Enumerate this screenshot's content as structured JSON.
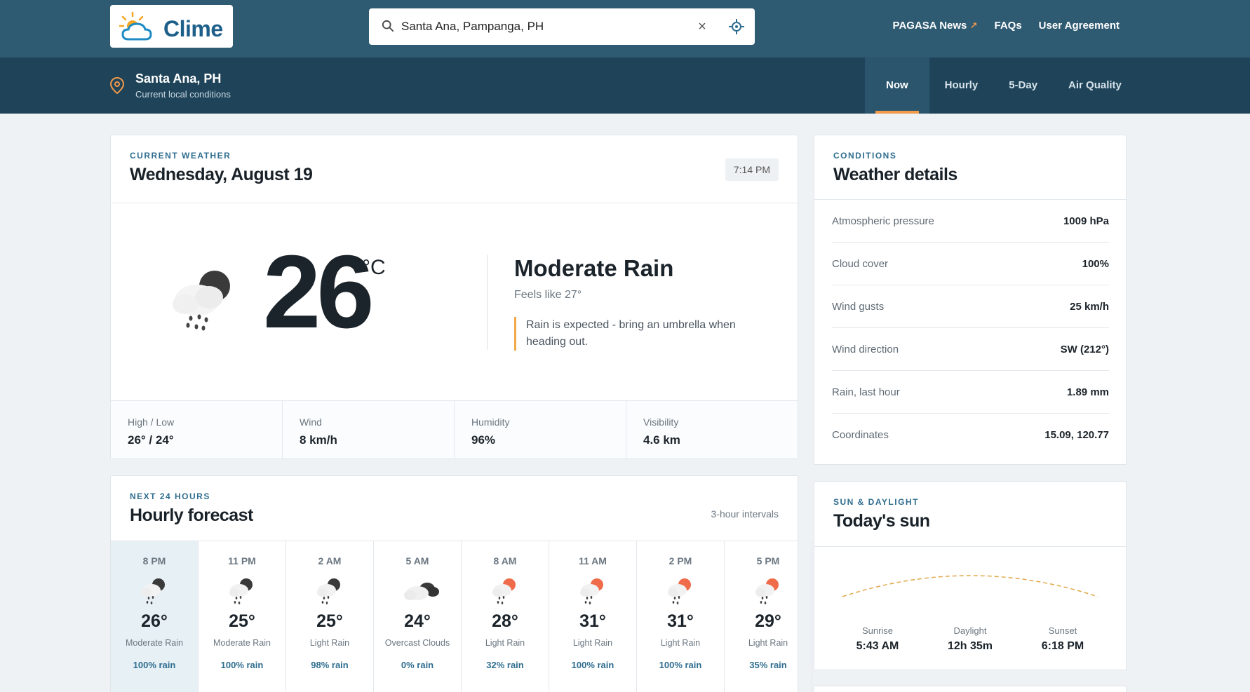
{
  "brand": {
    "name": "Clime"
  },
  "search": {
    "value": "Santa Ana, Pampanga, PH",
    "placeholder": ""
  },
  "topnav": {
    "news": "PAGASA News",
    "faqs": "FAQs",
    "agreement": "User Agreement"
  },
  "location": {
    "name": "Santa Ana, PH",
    "subtitle": "Current local conditions"
  },
  "tabs": [
    {
      "label": "Now"
    },
    {
      "label": "Hourly"
    },
    {
      "label": "5-Day"
    },
    {
      "label": "Air Quality"
    }
  ],
  "current": {
    "eyebrow": "Current weather",
    "date": "Wednesday, August 19",
    "time": "7:14 PM",
    "temp": "26",
    "unit": "°C",
    "condition": "Moderate Rain",
    "feels_like": "Feels like 27°",
    "advice": "Rain is expected - bring an umbrella when heading out.",
    "icon": "rain-night-icon",
    "stats": [
      {
        "label": "High / Low",
        "value": "26° / 24°"
      },
      {
        "label": "Wind",
        "value": "8 km/h"
      },
      {
        "label": "Humidity",
        "value": "96%"
      },
      {
        "label": "Visibility",
        "value": "4.6 km"
      }
    ]
  },
  "hourly": {
    "eyebrow": "Next 24 hours",
    "title": "Hourly forecast",
    "interval": "3-hour intervals",
    "items": [
      {
        "time": "8 PM",
        "temp": "26°",
        "cond": "Moderate Rain",
        "rain": "100% rain",
        "icon": "rain-night-icon"
      },
      {
        "time": "11 PM",
        "temp": "25°",
        "cond": "Moderate Rain",
        "rain": "100% rain",
        "icon": "rain-night-icon"
      },
      {
        "time": "2 AM",
        "temp": "25°",
        "cond": "Light Rain",
        "rain": "98% rain",
        "icon": "rain-night-icon"
      },
      {
        "time": "5 AM",
        "temp": "24°",
        "cond": "Overcast Clouds",
        "rain": "0% rain",
        "icon": "overcast-clouds-icon"
      },
      {
        "time": "8 AM",
        "temp": "28°",
        "cond": "Light Rain",
        "rain": "32% rain",
        "icon": "rain-day-icon"
      },
      {
        "time": "11 AM",
        "temp": "31°",
        "cond": "Light Rain",
        "rain": "100% rain",
        "icon": "rain-day-icon"
      },
      {
        "time": "2 PM",
        "temp": "31°",
        "cond": "Light Rain",
        "rain": "100% rain",
        "icon": "rain-day-icon"
      },
      {
        "time": "5 PM",
        "temp": "29°",
        "cond": "Light Rain",
        "rain": "35% rain",
        "icon": "rain-day-icon"
      }
    ]
  },
  "details": {
    "eyebrow": "Conditions",
    "title": "Weather details",
    "rows": [
      {
        "label": "Atmospheric pressure",
        "value": "1009 hPa"
      },
      {
        "label": "Cloud cover",
        "value": "100%"
      },
      {
        "label": "Wind gusts",
        "value": "25 km/h"
      },
      {
        "label": "Wind direction",
        "value": "SW (212°)"
      },
      {
        "label": "Rain, last hour",
        "value": "1.89 mm"
      },
      {
        "label": "Coordinates",
        "value": "15.09, 120.77"
      }
    ]
  },
  "sun": {
    "eyebrow": "Sun & daylight",
    "title": "Today's sun",
    "sunrise_label": "Sunrise",
    "sunrise": "5:43 AM",
    "daylight_label": "Daylight",
    "daylight": "12h 35m",
    "sunset_label": "Sunset",
    "sunset": "6:18 PM"
  },
  "colors": {
    "header": "#2e5a72",
    "subheader": "#1f4459",
    "accent": "#f2994a",
    "link": "#2f6d8f"
  }
}
